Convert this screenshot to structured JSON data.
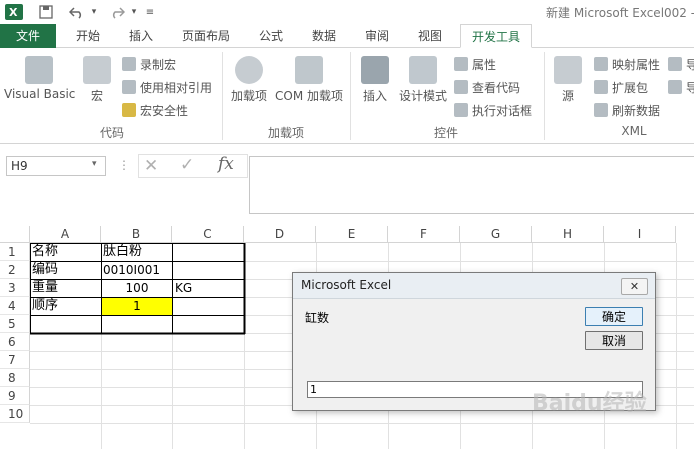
{
  "window": {
    "title": "新建 Microsoft Excel002 -"
  },
  "colors": {
    "file_tab": "#217346",
    "highlight_cell": "#ffff00",
    "accent": "#217346"
  },
  "tabs": [
    {
      "label": "文件"
    },
    {
      "label": "开始"
    },
    {
      "label": "插入"
    },
    {
      "label": "页面布局"
    },
    {
      "label": "公式"
    },
    {
      "label": "数据"
    },
    {
      "label": "审阅"
    },
    {
      "label": "视图"
    },
    {
      "label": "开发工具"
    }
  ],
  "ribbon": {
    "code": {
      "label": "代码",
      "visual_basic": "Visual Basic",
      "macros": "宏",
      "record_macro": "录制宏",
      "relative_ref": "使用相对引用",
      "macro_security": "宏安全性"
    },
    "addins": {
      "label": "加载项",
      "addins": "加载项",
      "com_addins": "COM 加载项"
    },
    "controls": {
      "label": "控件",
      "insert": "插入",
      "design_mode": "设计模式",
      "properties": "属性",
      "view_code": "查看代码",
      "run_dialog": "执行对话框"
    },
    "xml": {
      "label": "XML",
      "source": "源",
      "map_props": "映射属性",
      "expansion": "扩展包",
      "refresh": "刷新数据",
      "import_short": "导",
      "export_short": "导"
    }
  },
  "formula_bar": {
    "name_box": "H9",
    "fx": "fx",
    "value": ""
  },
  "columns": [
    "A",
    "B",
    "C",
    "D",
    "E",
    "F",
    "G",
    "H",
    "I"
  ],
  "rows": [
    "1",
    "2",
    "3",
    "4",
    "5",
    "6",
    "7",
    "8",
    "9",
    "10"
  ],
  "cells": {
    "A1": "名称",
    "B1": "肽白粉",
    "A2": "编码",
    "B2": "0010I001",
    "A3": "重量",
    "B3": "100",
    "C3": "KG",
    "A4": "顺序",
    "B4": "1"
  },
  "dialog": {
    "title": "Microsoft Excel",
    "prompt": "缸数",
    "ok": "确定",
    "cancel": "取消",
    "input_value": "1"
  },
  "watermark": "Baidu经验"
}
